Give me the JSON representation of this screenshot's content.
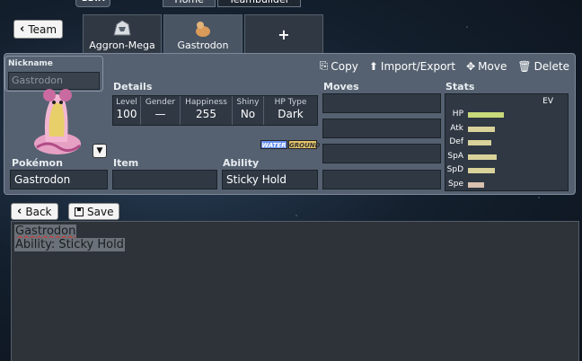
{
  "top_tabs": {
    "beta": "BETA",
    "home": "Home",
    "teambuilder": "Teambuilder"
  },
  "team_bar": {
    "back_label": "Team",
    "slots": [
      {
        "name": "Aggron-Mega"
      },
      {
        "name": "Gastrodon"
      },
      {
        "name": "+"
      }
    ]
  },
  "toolbar": {
    "copy": "Copy",
    "import_export": "Import/Export",
    "move": "Move",
    "delete": "Delete"
  },
  "nickname": {
    "label": "Nickname",
    "placeholder": "Gastrodon"
  },
  "details": {
    "label": "Details",
    "level_h": "Level",
    "level": "100",
    "gender_h": "Gender",
    "gender": "—",
    "happiness_h": "Happiness",
    "happiness": "255",
    "shiny_h": "Shiny",
    "shiny": "No",
    "hptype_h": "HP Type",
    "hptype": "Dark"
  },
  "types": [
    "WATER",
    "GROUND"
  ],
  "type_colors": {
    "water": "#6890f0",
    "ground": "#e0c068"
  },
  "labels": {
    "pokemon": "Pokémon",
    "item": "Item",
    "ability": "Ability",
    "moves": "Moves",
    "stats": "Stats",
    "ev": "EV"
  },
  "pokemon": "Gastrodon",
  "item": "",
  "ability": "Sticky Hold",
  "moves": [
    "",
    "",
    "",
    ""
  ],
  "stats": [
    {
      "name": "HP",
      "fill": 0.72,
      "color": "#c9d97a"
    },
    {
      "name": "Atk",
      "fill": 0.55,
      "color": "#d9d29a"
    },
    {
      "name": "Def",
      "fill": 0.48,
      "color": "#d9d29a"
    },
    {
      "name": "SpA",
      "fill": 0.58,
      "color": "#d9d29a"
    },
    {
      "name": "SpD",
      "fill": 0.55,
      "color": "#d9d29a"
    },
    {
      "name": "Spe",
      "fill": 0.33,
      "color": "#d9c2b0"
    }
  ],
  "bottom": {
    "back": "Back",
    "save": "Save"
  },
  "export_text": {
    "line1": "Gastrodon",
    "line2": "Ability: Sticky Hold"
  }
}
